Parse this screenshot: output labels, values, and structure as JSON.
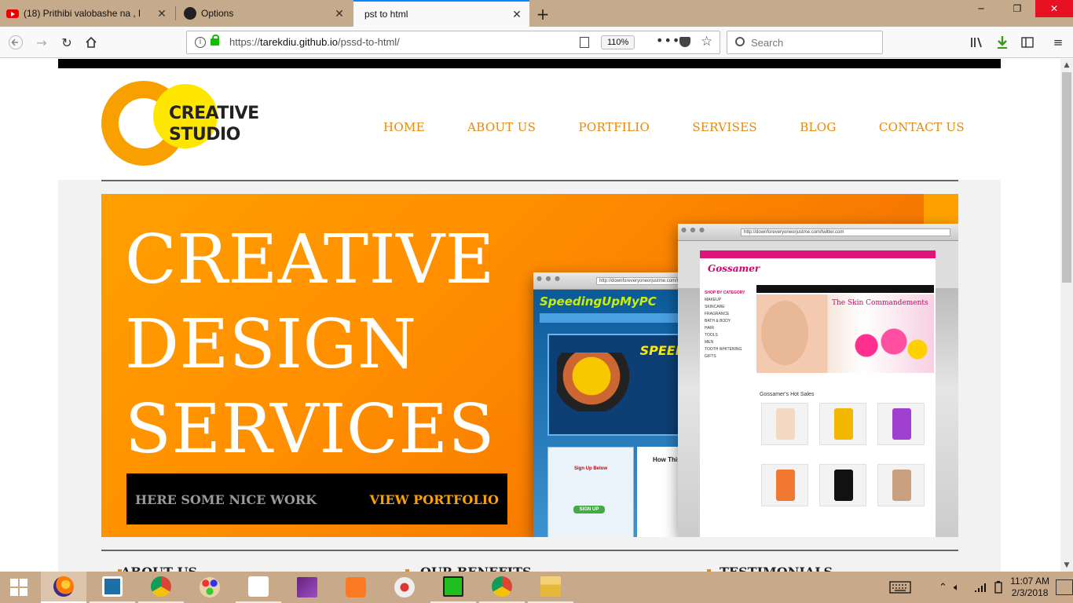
{
  "browser": {
    "tabs": [
      {
        "title": "(18) Prithibi valobashe na , l",
        "icon": "youtube-icon",
        "active": false
      },
      {
        "title": "Options",
        "icon": "github-icon",
        "active": false
      },
      {
        "title": "pst to html",
        "icon": "none",
        "active": true
      }
    ],
    "url_scheme": "https://",
    "url_host": "tarekdiu.github.io",
    "url_path": "/pssd-to-html/",
    "zoom": "110%",
    "search_placeholder": "Search"
  },
  "site": {
    "logo_line1": "CREATIVE",
    "logo_line2": "STUDIO",
    "nav": [
      "HOME",
      "ABOUT US",
      "PORTFILIO",
      "SERVISES",
      "BLOG",
      "CONTACT US"
    ],
    "hero": {
      "title_line1": "CREATIVE",
      "title_line2": "DESIGN",
      "title_line3": "SERVICES",
      "bar_left": "HERE SOME NICE WORK",
      "bar_right": "VIEW PORTFOLIO"
    },
    "mockups": {
      "m1_url": "http://downforeveryoneorjustme.com/twitter.com",
      "m1_brand": "SpeedingUpMyPC",
      "m1_speed": "SPEED",
      "m1_panel_title": "Sign Up Below",
      "m1_signup": "SIGN UP",
      "m1_how": "How This",
      "m2_url": "http://downforeveryoneorjustme.com/twitter.com",
      "m2_logo": "Gossamer",
      "m2_hero_title": "The Skin Commandements",
      "m2_hot": "Gossamer's Hot Sales",
      "m2_side_head": "SHOP BY CATEGORY",
      "m2_side_items": [
        "MAKEUP",
        "SKINCARE",
        "FRAGRANCE",
        "BATH & BODY",
        "HAIR",
        "TOOLS",
        "MEN",
        "TOOTH WHITENING",
        "GIFTS"
      ]
    },
    "sections": [
      "ABOUT US",
      "OUR BENEFITS",
      "TESTIMONIALS"
    ]
  },
  "colors": {
    "accent": "#e8890a",
    "hero_orange": "#ff8c00",
    "hero_bar_link": "#ffa200",
    "logo_yellow": "#ffe600"
  },
  "taskbar": {
    "apps": [
      "firefox-icon",
      "brackets-icon",
      "chrome-icon",
      "paint-icon",
      "cursor-tool-icon",
      "visual-studio-icon",
      "xampp-icon",
      "snipping-icon",
      "cpu-monitor-icon",
      "chrome-icon",
      "file-explorer-icon"
    ],
    "time": "11:07 AM",
    "date": "2/3/2018"
  }
}
